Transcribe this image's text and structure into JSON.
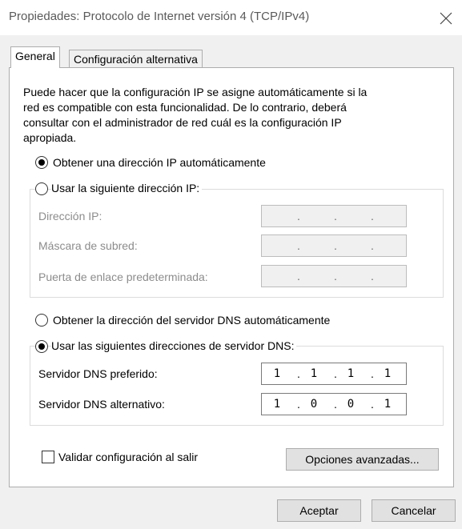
{
  "window": {
    "title": "Propiedades: Protocolo de Internet versión 4 (TCP/IPv4)"
  },
  "tabs": [
    {
      "label": "General",
      "active": true
    },
    {
      "label": "Configuración alternativa",
      "active": false
    }
  ],
  "description": [
    "Puede hacer que la configuración IP se asigne automáticamente si la",
    "red es compatible con esta funcionalidad. De lo contrario, deberá",
    "consultar con el administrador de red cuál es la configuración IP",
    "apropiada."
  ],
  "ip_section": {
    "auto_option": {
      "label": "Obtener una dirección IP automáticamente",
      "selected": true
    },
    "manual_option": {
      "label": "Usar la siguiente dirección IP:",
      "selected": false
    },
    "fields": [
      {
        "label": "Dirección IP:",
        "value": [
          "",
          "",
          "",
          ""
        ],
        "enabled": false
      },
      {
        "label": "Máscara de subred:",
        "value": [
          "",
          "",
          "",
          ""
        ],
        "enabled": false
      },
      {
        "label": "Puerta de enlace predeterminada:",
        "value": [
          "",
          "",
          "",
          ""
        ],
        "enabled": false
      }
    ]
  },
  "dns_section": {
    "auto_option": {
      "label": "Obtener la dirección del servidor DNS automáticamente",
      "selected": false
    },
    "manual_option": {
      "label": "Usar las siguientes direcciones de servidor DNS:",
      "selected": true
    },
    "fields": [
      {
        "label": "Servidor DNS preferido:",
        "value": [
          "1",
          "1",
          "1",
          "1"
        ],
        "enabled": true
      },
      {
        "label": "Servidor DNS alternativo:",
        "value": [
          "1",
          "0",
          "0",
          "1"
        ],
        "enabled": true
      }
    ]
  },
  "validate_on_exit": {
    "label": "Validar configuración al salir",
    "checked": false
  },
  "buttons": {
    "advanced": "Opciones avanzadas...",
    "ok": "Aceptar",
    "cancel": "Cancelar"
  },
  "colors": {
    "panel_background": "#ffffff",
    "dialog_background": "#f0f0f0",
    "disabled_text": "#8c8c8c"
  }
}
